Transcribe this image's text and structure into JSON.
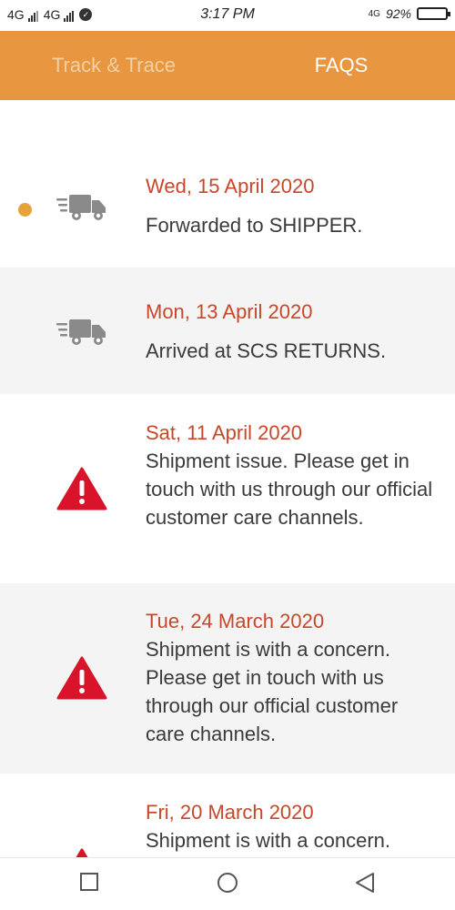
{
  "status_bar": {
    "network_1": "4G",
    "network_2": "4G",
    "time": "3:17 PM",
    "network_right": "4G",
    "battery_percent": "92%",
    "battery_level": 0.92
  },
  "tabs": [
    {
      "label": "Track & Trace",
      "active": false
    },
    {
      "label": "FAQS",
      "active": true
    }
  ],
  "events": [
    {
      "date": "Wed, 15 April 2020",
      "description": "Forwarded to SHIPPER.",
      "icon": "truck-icon",
      "current": true
    },
    {
      "date": "Mon, 13 April 2020",
      "description": "Arrived at SCS RETURNS.",
      "icon": "truck-icon",
      "current": false
    },
    {
      "date": "Sat, 11 April 2020",
      "description": "Shipment issue. Please get in touch with us through our official customer care channels.",
      "icon": "warning-icon",
      "current": false
    },
    {
      "date": "Tue, 24 March 2020",
      "description": "Shipment is with a concern. Please get in touch with us through our official customer care channels.",
      "icon": "warning-icon",
      "current": false
    },
    {
      "date": "Fri, 20 March 2020",
      "description": "Shipment is with a concern.",
      "icon": "warning-icon",
      "current": false
    }
  ],
  "colors": {
    "header": "#e8963f",
    "date_text": "#c8472a",
    "current_dot": "#e8a23a",
    "warning": "#d9142a"
  },
  "nav": [
    "recents-button",
    "home-button",
    "back-button"
  ]
}
